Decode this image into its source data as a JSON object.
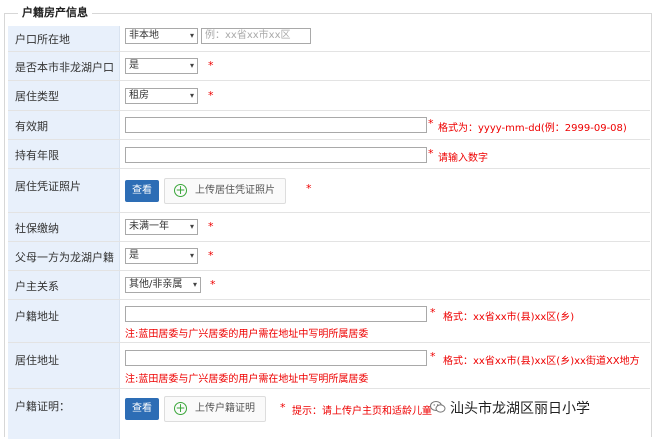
{
  "section_title": "户籍房产信息",
  "rows": {
    "hukou_location": {
      "label": "户口所在地",
      "select": "非本地",
      "placeholder": "例：xx省xx市xx区"
    },
    "is_longhu": {
      "label": "是否本市非龙湖户口",
      "select": "是",
      "star": "*"
    },
    "residence_type": {
      "label": "居住类型",
      "select": "租房",
      "star": "*"
    },
    "validity": {
      "label": "有效期",
      "star": "*",
      "hint": "格式为：yyyy-mm-dd(例：2999-09-08)"
    },
    "years": {
      "label": "持有年限",
      "star": "*",
      "hint": "请输入数字"
    },
    "residence_photo": {
      "label": "居住凭证照片",
      "view": "查看",
      "upload": "上传居住凭证照片",
      "star": "*"
    },
    "social_security": {
      "label": "社保缴纳",
      "select": "未满一年",
      "star": "*"
    },
    "parent_longhu": {
      "label": "父母一方为龙湖户籍",
      "select": "是",
      "star": "*"
    },
    "householder": {
      "label": "户主关系",
      "select": "其他/非亲属",
      "star": "*"
    },
    "hukou_address": {
      "label": "户籍地址",
      "star": "*",
      "hint": "格式：xx省xx市(县)xx区(乡)",
      "note": "注:蓝田居委与广兴居委的用户需在地址中写明所属居委"
    },
    "live_address": {
      "label": "居住地址",
      "star": "*",
      "hint": "格式：xx省xx市(县)xx区(乡)xx街道XX地方",
      "note": "注:蓝田居委与广兴居委的用户需在地址中写明所属居委"
    },
    "hukou_proof": {
      "label": "户籍证明：",
      "view": "查看",
      "upload": "上传户籍证明",
      "star": "*",
      "hint": "提示：请上传户主页和适龄儿童"
    }
  },
  "watermark": "汕头市龙湖区丽日小学",
  "icons": {
    "caret": "chevron-down-icon",
    "plus": "plus-circle-icon",
    "wechat": "wechat-icon"
  }
}
